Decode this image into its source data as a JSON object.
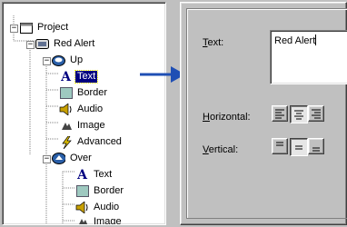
{
  "tree": {
    "root": "Project",
    "items": [
      {
        "label": "Red Alert",
        "icon": "monitor-icon"
      },
      {
        "label": "Up",
        "icon": "state-up-icon"
      },
      {
        "label": "Text",
        "icon": "text-a-icon",
        "selected": true
      },
      {
        "label": "Border",
        "icon": "border-icon"
      },
      {
        "label": "Audio",
        "icon": "speaker-icon"
      },
      {
        "label": "Image",
        "icon": "image-icon"
      },
      {
        "label": "Advanced",
        "icon": "lightning-icon"
      },
      {
        "label": "Over",
        "icon": "state-over-icon"
      },
      {
        "label": "Text",
        "icon": "text-a-icon"
      },
      {
        "label": "Border",
        "icon": "border-icon"
      },
      {
        "label": "Audio",
        "icon": "speaker-icon"
      },
      {
        "label": "Image",
        "icon": "image-icon"
      }
    ]
  },
  "props": {
    "text_label": "Text:",
    "text_accel": "T",
    "text_value": "Red Alert",
    "horizontal_label": "Horizontal:",
    "horizontal_accel": "H",
    "vertical_label": "Vertical:",
    "vertical_accel": "V"
  },
  "colors": {
    "selection": "#000080",
    "arrow": "#1f4fb4"
  }
}
